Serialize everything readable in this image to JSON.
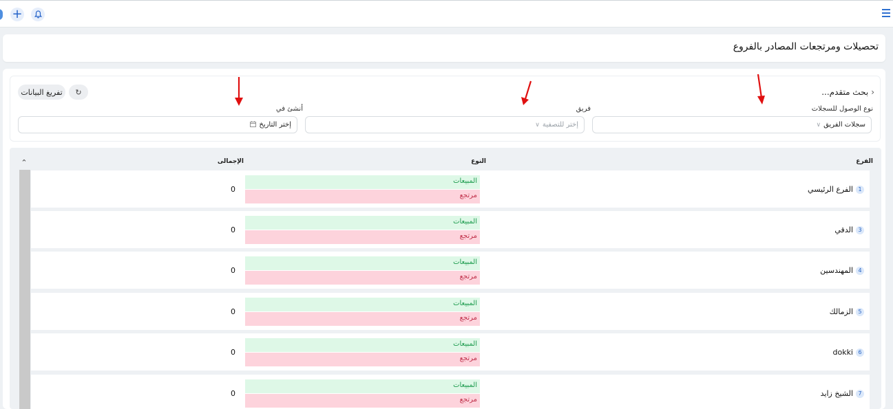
{
  "page": {
    "title": "تحصيلات ومرتجعات المصادر بالفروع"
  },
  "filters": {
    "advanced_search": "بحث متقدم...",
    "export_label": "تفريغ البيانات",
    "access_type_label": "نوع الوصول للسجلات",
    "access_type_value": "سجلات الفريق",
    "team_label": "فريق",
    "team_placeholder": "إختر للتصفية",
    "created_in_label": "أنشئ في",
    "created_in_placeholder": "إختر التاريخ"
  },
  "table": {
    "headers": {
      "branch": "الفرع",
      "type": "النوع",
      "total": "الإجمالى"
    },
    "sales_label": "المبيعات",
    "return_label": "مرتجع",
    "rows": [
      {
        "index": "1",
        "branch": "الفرع الرئيسي",
        "total": "0"
      },
      {
        "index": "3",
        "branch": "الدقي",
        "total": "0"
      },
      {
        "index": "4",
        "branch": "المهندسين",
        "total": "0"
      },
      {
        "index": "5",
        "branch": "الزمالك",
        "total": "0"
      },
      {
        "index": "6",
        "branch": "dokki",
        "total": "0"
      },
      {
        "index": "7",
        "branch": "الشيخ زايد",
        "total": "0"
      }
    ]
  },
  "colors": {
    "accent": "#2d6fd0",
    "sales_bg": "#def8e7",
    "sales_text": "#1c9b4d",
    "return_bg": "#fdd3dc",
    "return_text": "#c0304a",
    "annotation_arrow": "#e01010"
  },
  "icons": {
    "add": "plus-icon",
    "notifications": "bell-icon",
    "menu": "hamburger-menu-icon",
    "refresh": "refresh-icon",
    "calendar": "calendar-icon",
    "collapse": "chevron-up-icon"
  }
}
